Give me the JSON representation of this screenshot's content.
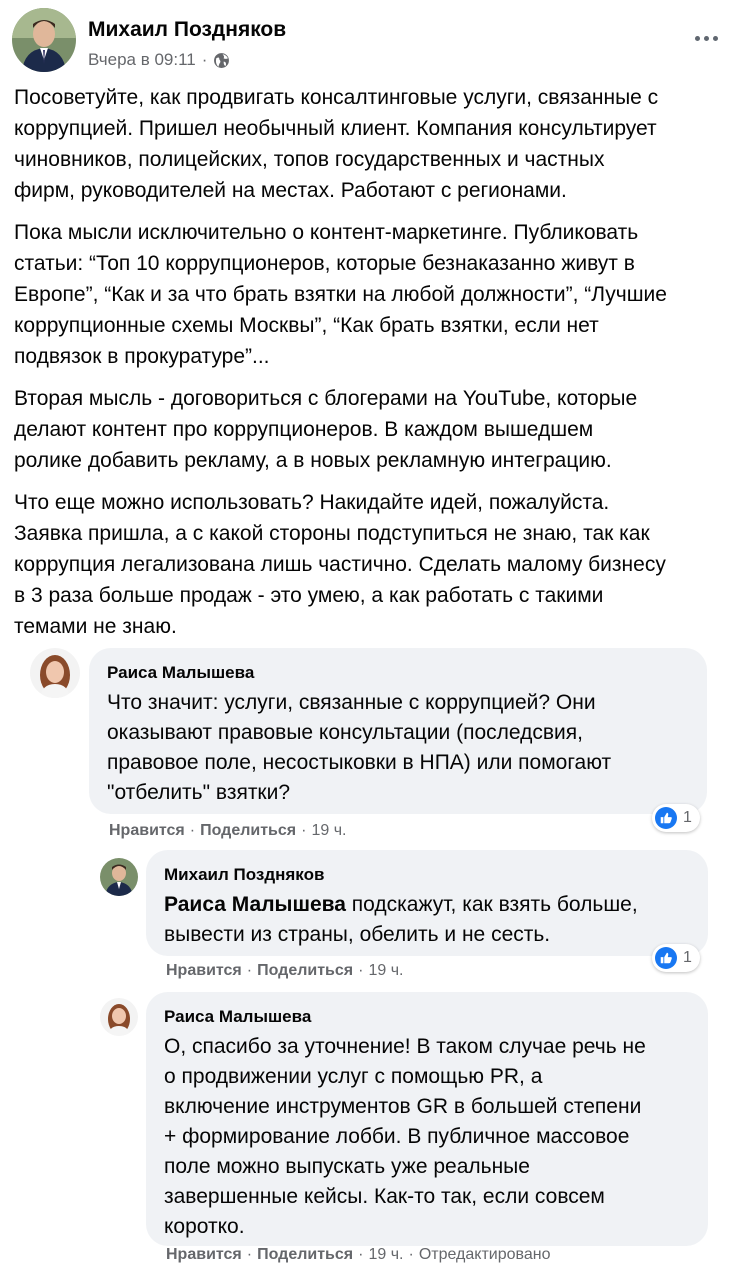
{
  "post": {
    "author": "Михаил Поздняков",
    "time": "Вчера в 09:11",
    "privacy_icon": "globe-icon",
    "paragraphs": [
      "Посоветуйте, как продвигать консалтинговые услуги, связанные с\nкоррупцией. Пришел необычный клиент. Компания консультирует\nчиновников, полицейских, топов государственных и частных\nфирм, руководителей на местах. Работают с регионами.",
      "Пока мысли исключительно о контент-маркетинге. Публиковать\nстатьи: “Топ 10 коррупционеров, которые безнаказанно живут в\nЕвропе”, “Как и за что брать взятки на любой должности”, “Лучшие\nкоррупционные схемы Москвы”, “Как брать взятки, если нет\nподвязок в прокуратуре”...",
      "Вторая мысль - договориться с блогерами на YouTube, которые\nделают контент про коррупционеров. В каждом вышедшем\nролике добавить рекламу, а в новых рекламную интеграцию.",
      "Что еще можно использовать? Накидайте идей, пожалуйста.\nЗаявка пришла, а с какой стороны подступиться не знаю, так как\nкоррупция легализована лишь частично. Сделать малому бизнесу\nв 3 раза больше продаж - это умею, а как работать с такими\nтемами не знаю."
    ]
  },
  "comments": [
    {
      "author": "Раиса Малышева",
      "text": "Что значит: услуги, связанные с коррупцией? Они\nоказывают правовые консультации (последсвия,\nправовое поле, несостыковки в НПА) или помогают\n\"отбелить\" взятки?",
      "like": "Нравится",
      "share": "Поделиться",
      "time": "19 ч.",
      "reactions": "1"
    },
    {
      "author": "Михаил Поздняков",
      "mention": "Раиса Малышева",
      "text": " подскажут, как взять больше,\nвывести из страны, обелить и не сесть.",
      "like": "Нравится",
      "share": "Поделиться",
      "time": "19 ч.",
      "reactions": "1"
    },
    {
      "author": "Раиса Малышева",
      "text": "О, спасибо за уточнение! В таком случае речь не\nо продвижении услуг с помощью PR, а\nвключение инструментов GR в большей степени\n+ формирование лобби. В публичное массовое\nполе можно выпускать уже реальные\nзавершенные кейсы. Как-то так, если совсем\nкоротко.",
      "like": "Нравится",
      "share": "Поделиться",
      "time": "19 ч.",
      "edited": "Отредактировано"
    }
  ],
  "separator": "·",
  "colors": {
    "bubble": "#f0f2f5",
    "meta": "#65676b",
    "like_blue": "#1877f2"
  }
}
